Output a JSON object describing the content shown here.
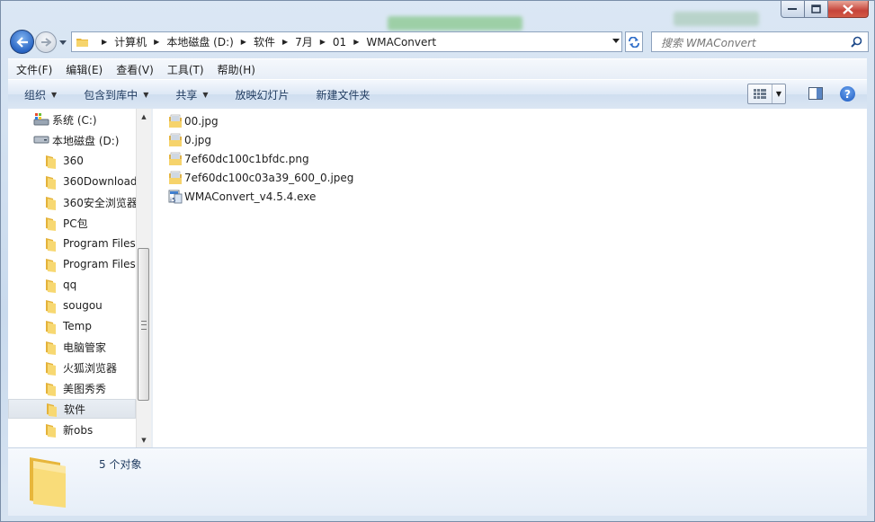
{
  "titlebar": {
    "buttons": {
      "minimize": "minimize",
      "maximize": "maximize",
      "close": "close"
    }
  },
  "address": {
    "crumbs": [
      "计算机",
      "本地磁盘 (D:)",
      "软件",
      "7月",
      "01",
      "WMAConvert"
    ]
  },
  "search": {
    "placeholder": "搜索 WMAConvert"
  },
  "menu": [
    "文件(F)",
    "编辑(E)",
    "查看(V)",
    "工具(T)",
    "帮助(H)"
  ],
  "toolbar": {
    "organize": "组织",
    "include_library": "包含到库中",
    "share": "共享",
    "slideshow": "放映幻灯片",
    "new_folder": "新建文件夹"
  },
  "tree": {
    "items": [
      {
        "label": "系统 (C:)",
        "icon": "system-drive-icon"
      },
      {
        "label": "本地磁盘 (D:)",
        "icon": "local-drive-icon"
      },
      {
        "label": "360",
        "icon": "folder-icon"
      },
      {
        "label": "360Download",
        "icon": "folder-icon"
      },
      {
        "label": "360安全浏览器",
        "icon": "folder-icon"
      },
      {
        "label": "PC包",
        "icon": "folder-icon"
      },
      {
        "label": "Program Files",
        "icon": "folder-icon"
      },
      {
        "label": "Program Files",
        "icon": "folder-icon"
      },
      {
        "label": "qq",
        "icon": "folder-icon"
      },
      {
        "label": "sougou",
        "icon": "folder-icon"
      },
      {
        "label": "Temp",
        "icon": "folder-icon"
      },
      {
        "label": "电脑管家",
        "icon": "folder-icon"
      },
      {
        "label": "火狐浏览器",
        "icon": "folder-icon"
      },
      {
        "label": "美图秀秀",
        "icon": "folder-icon"
      },
      {
        "label": "软件",
        "icon": "folder-icon",
        "selected": true
      },
      {
        "label": "新obs",
        "icon": "folder-icon"
      }
    ]
  },
  "files": [
    {
      "name": "00.jpg",
      "icon": "image-file-icon"
    },
    {
      "name": "0.jpg",
      "icon": "image-file-icon"
    },
    {
      "name": "7ef60dc100c1bfdc.png",
      "icon": "image-file-icon"
    },
    {
      "name": "7ef60dc100c03a39_600_0.jpeg",
      "icon": "image-file-icon"
    },
    {
      "name": "WMAConvert_v4.5.4.exe",
      "icon": "installer-icon"
    }
  ],
  "details": {
    "count": "5 个对象"
  },
  "colors": {
    "accent": "#1b59c0",
    "folder": "#f3c84f",
    "chrome": "#d6e3f1"
  }
}
